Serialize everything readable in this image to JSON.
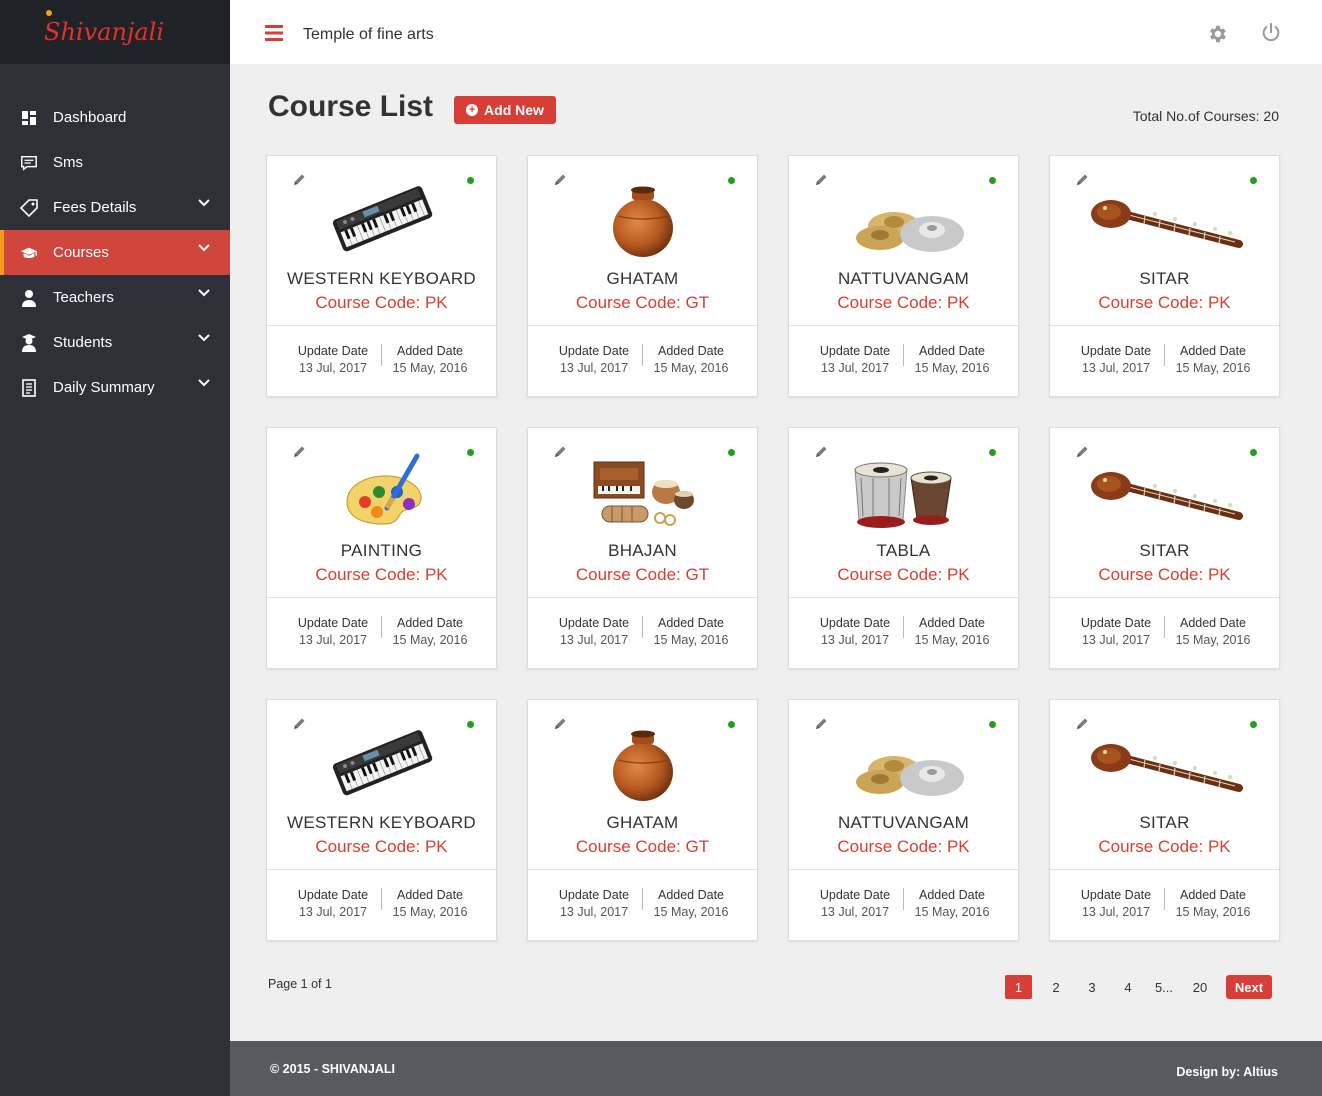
{
  "brand": {
    "logo_text": "Shivanjali"
  },
  "header": {
    "title": "Temple of fine arts"
  },
  "sidebar": {
    "items": [
      {
        "label": "Dashboard",
        "icon": "dashboard-icon",
        "has_submenu": false
      },
      {
        "label": "Sms",
        "icon": "message-icon",
        "has_submenu": false
      },
      {
        "label": "Fees Details",
        "icon": "tag-icon",
        "has_submenu": true
      },
      {
        "label": "Courses",
        "icon": "graduation-cap-icon",
        "has_submenu": true,
        "active": true
      },
      {
        "label": "Teachers",
        "icon": "teacher-icon",
        "has_submenu": true
      },
      {
        "label": "Students",
        "icon": "student-icon",
        "has_submenu": true
      },
      {
        "label": "Daily Summary",
        "icon": "document-icon",
        "has_submenu": true
      }
    ]
  },
  "main": {
    "title": "Course List",
    "add_label": "Add New",
    "total_label": "Total No.of Courses: 20",
    "update_label": "Update Date",
    "added_label": "Added Date",
    "courses": [
      {
        "name": "WESTERN KEYBOARD",
        "code": "Course Code: PK",
        "update": "13 Jul, 2017",
        "added": "15 May, 2016",
        "image": "keyboard"
      },
      {
        "name": "GHATAM",
        "code": "Course Code: GT",
        "update": "13 Jul, 2017",
        "added": "15 May, 2016",
        "image": "ghatam"
      },
      {
        "name": "NATTUVANGAM",
        "code": "Course Code: PK",
        "update": "13 Jul, 2017",
        "added": "15 May, 2016",
        "image": "cymbals"
      },
      {
        "name": "SITAR",
        "code": "Course Code: PK",
        "update": "13 Jul, 2017",
        "added": "15 May, 2016",
        "image": "sitar"
      },
      {
        "name": "PAINTING",
        "code": "Course Code: PK",
        "update": "13 Jul, 2017",
        "added": "15 May, 2016",
        "image": "palette"
      },
      {
        "name": "BHAJAN",
        "code": "Course Code: GT",
        "update": "13 Jul, 2017",
        "added": "15 May, 2016",
        "image": "bhajan"
      },
      {
        "name": "TABLA",
        "code": "Course Code: PK",
        "update": "13 Jul, 2017",
        "added": "15 May, 2016",
        "image": "tabla"
      },
      {
        "name": "SITAR",
        "code": "Course Code: PK",
        "update": "13 Jul, 2017",
        "added": "15 May, 2016",
        "image": "sitar"
      },
      {
        "name": "WESTERN KEYBOARD",
        "code": "Course Code: PK",
        "update": "13 Jul, 2017",
        "added": "15 May, 2016",
        "image": "keyboard"
      },
      {
        "name": "GHATAM",
        "code": "Course Code: GT",
        "update": "13 Jul, 2017",
        "added": "15 May, 2016",
        "image": "ghatam"
      },
      {
        "name": "NATTUVANGAM",
        "code": "Course Code: PK",
        "update": "13 Jul, 2017",
        "added": "15 May, 2016",
        "image": "cymbals"
      },
      {
        "name": "SITAR",
        "code": "Course Code: PK",
        "update": "13 Jul, 2017",
        "added": "15 May, 2016",
        "image": "sitar"
      }
    ]
  },
  "pagination": {
    "info": "Page 1 of 1",
    "pages": [
      "1",
      "2",
      "3",
      "4",
      "5...",
      "20"
    ],
    "current": "1",
    "next_label": "Next"
  },
  "footer": {
    "copyright": "© 2015 - SHIVANJALI",
    "design": "Design by: Altius"
  },
  "colors": {
    "accent": "#d73e36",
    "sidebar": "#2d3036",
    "active_indicator": "#f39a1f",
    "status_active": "#25a015",
    "footer": "#585a5f"
  }
}
